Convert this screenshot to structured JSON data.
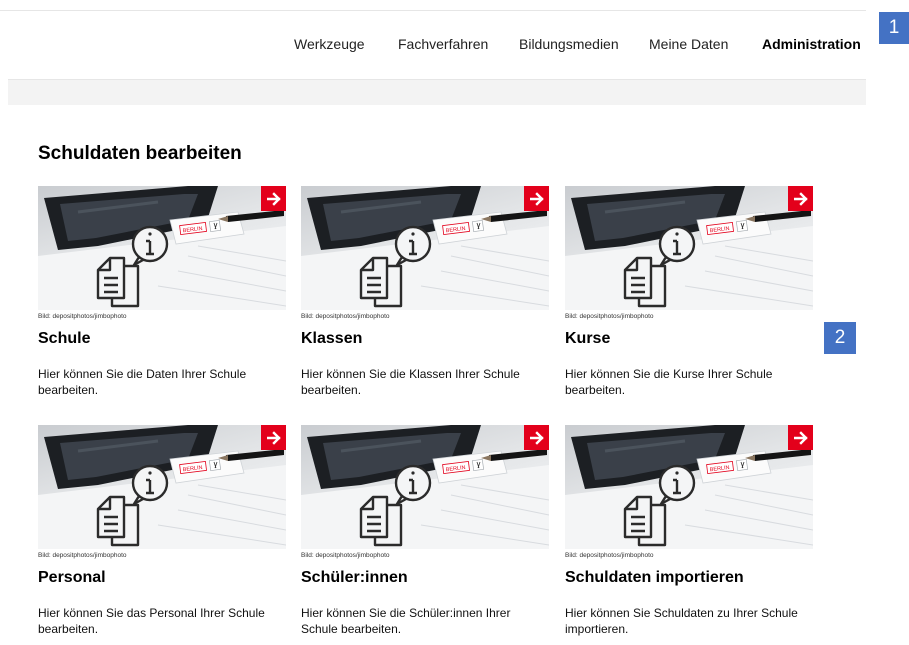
{
  "nav": {
    "items": [
      {
        "label": "Werkzeuge"
      },
      {
        "label": "Fachverfahren"
      },
      {
        "label": "Bildungsmedien"
      },
      {
        "label": "Meine Daten"
      },
      {
        "label": "Administration",
        "active": true
      }
    ]
  },
  "markers": {
    "first": "1",
    "second": "2"
  },
  "section": {
    "title": "Schuldaten bearbeiten"
  },
  "cards": [
    {
      "title": "Schule",
      "credit": "Bild: depositphotos/jimbophoto",
      "description": "Hier können Sie die Daten Ihrer Schule bearbeiten.",
      "stamp": "BERLIN"
    },
    {
      "title": "Klassen",
      "credit": "Bild: depositphotos/jimbophoto",
      "description": "Hier können Sie die Klassen Ihrer Schule bearbeiten.",
      "stamp": "BERLIN"
    },
    {
      "title": "Kurse",
      "credit": "Bild: depositphotos/jimbophoto",
      "description": "Hier können Sie die Kurse Ihrer Schule bearbeiten.",
      "stamp": "BERLIN"
    },
    {
      "title": "Personal",
      "credit": "Bild: depositphotos/jimbophoto",
      "description": "Hier können Sie das Personal Ihrer Schule bearbeiten.",
      "stamp": "BERLIN"
    },
    {
      "title": "Schüler:innen",
      "credit": "Bild: depositphotos/jimbophoto",
      "description": "Hier können Sie die Schüler:innen Ihrer Schule bearbeiten.",
      "stamp": "BERLIN"
    },
    {
      "title": "Schuldaten importieren",
      "credit": "Bild: depositphotos/jimbophoto",
      "description": "Hier können Sie Schuldaten zu Ihrer Schule importieren.",
      "stamp": "BERLIN"
    }
  ],
  "icons": {
    "card_arrow": "arrow-right-icon",
    "card_pictogram": "document-info-icon"
  },
  "colors": {
    "accent": "#e3001b",
    "marker": "#4472c4"
  }
}
